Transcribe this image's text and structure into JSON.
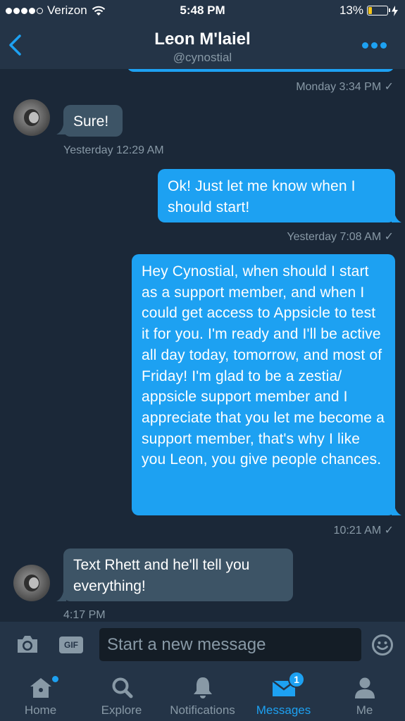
{
  "status_bar": {
    "carrier": "Verizon",
    "time": "5:48 PM",
    "battery_percent": "13%",
    "signal_bars_filled": 4,
    "signal_bars_total": 5,
    "battery_level": 0.13
  },
  "header": {
    "name": "Leon M'laiel",
    "handle": "@cynostial"
  },
  "messages": [
    {
      "direction": "out",
      "text": "",
      "timestamp": "Monday 3:34 PM ✓"
    },
    {
      "direction": "in",
      "text": "Sure!",
      "timestamp": "Yesterday 12:29 AM"
    },
    {
      "direction": "out",
      "text": "Ok! Just let me know when I should start!",
      "timestamp": "Yesterday 7:08 AM ✓"
    },
    {
      "direction": "out",
      "text": "Hey Cynostial, when should I start as a support member, and when I could get access to Appsicle to test it for you. I'm ready and I'll be active all day today, tomorrow, and most of Friday! I'm glad to be a zestia/ appsicle support member and I appreciate that you let me become a support member, that's why I like you Leon, you give people chances.",
      "timestamp": "10:21 AM ✓"
    },
    {
      "direction": "in",
      "text": "Text Rhett and he'll tell you everything!",
      "timestamp": "4:17 PM"
    }
  ],
  "composer": {
    "placeholder": "Start a new message",
    "gif_label": "GIF"
  },
  "tabs": [
    {
      "label": "Home",
      "icon": "home-icon",
      "active": false,
      "has_dot": true
    },
    {
      "label": "Explore",
      "icon": "search-icon",
      "active": false
    },
    {
      "label": "Notifications",
      "icon": "bell-icon",
      "active": false
    },
    {
      "label": "Messages",
      "icon": "envelope-icon",
      "active": true,
      "badge": "1"
    },
    {
      "label": "Me",
      "icon": "person-icon",
      "active": false
    }
  ],
  "colors": {
    "accent": "#1da1f2",
    "background": "#1b2838",
    "bar": "#243447",
    "incoming_bubble": "#3d5466",
    "muted_text": "#8899a6"
  }
}
